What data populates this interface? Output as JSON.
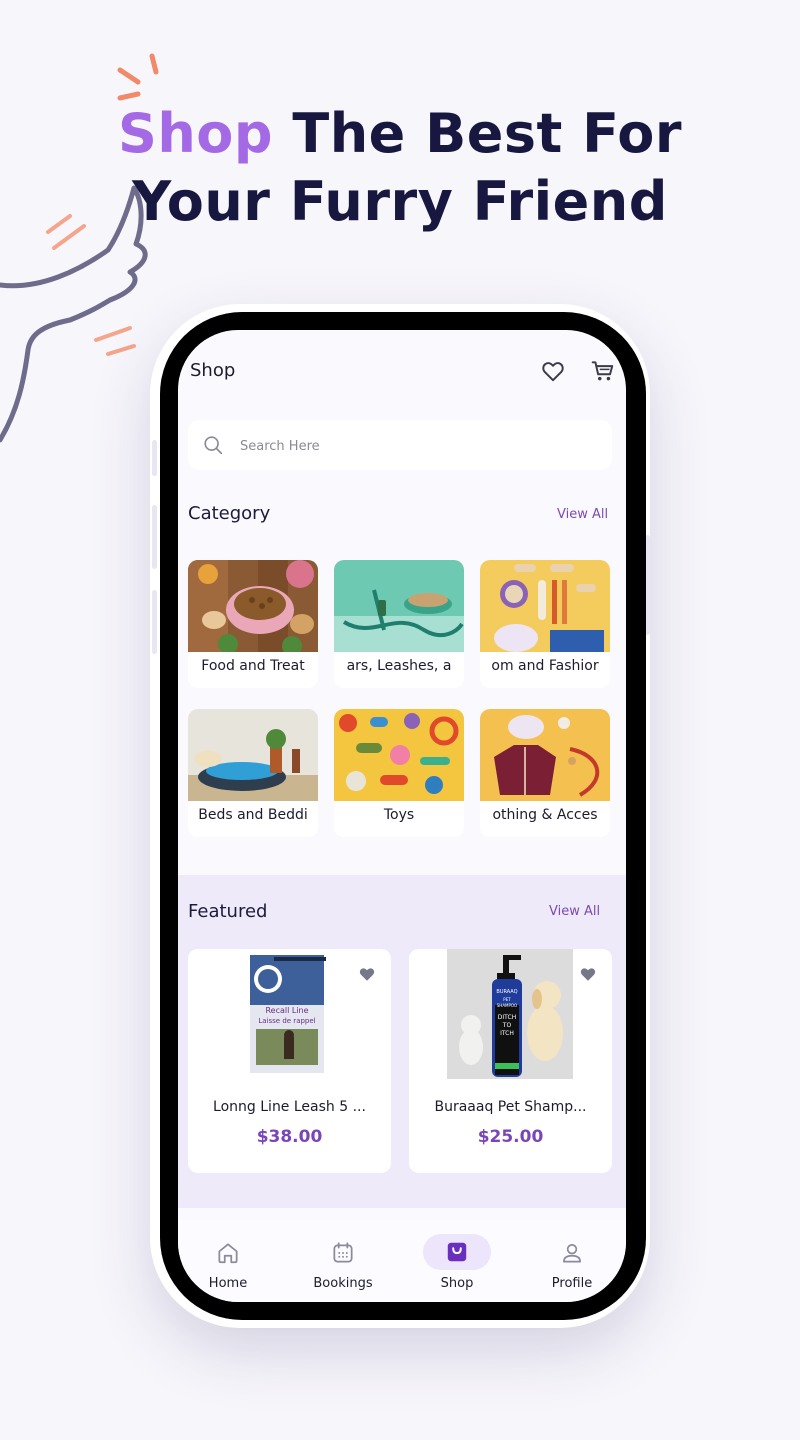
{
  "headline": {
    "accent": "Shop",
    "rest_line1": " The Best For",
    "line2": "Your Furry Friend"
  },
  "topbar": {
    "title": "Shop",
    "icons": [
      "heart-icon",
      "cart-icon"
    ]
  },
  "search": {
    "placeholder": "Search Here",
    "value": ""
  },
  "category": {
    "title": "Category",
    "view_all": "View All",
    "items": [
      {
        "label": "Food and Treat"
      },
      {
        "label": "ars, Leashes, a"
      },
      {
        "label": "om and Fashior"
      },
      {
        "label": "Beds and Beddi"
      },
      {
        "label": "Toys"
      },
      {
        "label": "othing & Acces"
      }
    ]
  },
  "featured": {
    "title": "Featured",
    "view_all": "View All",
    "products": [
      {
        "name": "Lonng Line Leash 5 ...",
        "price": "$38.00",
        "package_text": [
          "Recall Line",
          "Laisse de rappel"
        ]
      },
      {
        "name": "Buraaaq Pet Shamp...",
        "price": "$25.00",
        "bottle_text": [
          "BURAAQ",
          "PET",
          "SHAMPOO",
          "DITCH",
          "TO",
          "ITCH"
        ]
      }
    ]
  },
  "nav": {
    "items": [
      {
        "label": "Home",
        "icon": "home-icon"
      },
      {
        "label": "Bookings",
        "icon": "calendar-icon"
      },
      {
        "label": "Shop",
        "icon": "shopping-bag-icon",
        "active": true
      },
      {
        "label": "Profile",
        "icon": "user-icon"
      }
    ]
  },
  "colors": {
    "accent": "#a46ae6",
    "price": "#7a45b8",
    "headline": "#17173f",
    "featured_bg": "#efeafa"
  }
}
